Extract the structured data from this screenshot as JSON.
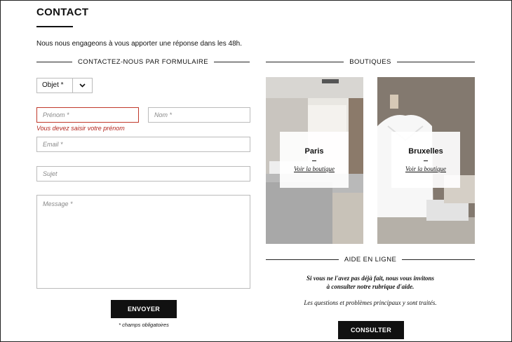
{
  "page": {
    "title": "CONTACT",
    "intro": "Nous nous engageons à vous apporter une réponse dans les 48h."
  },
  "form": {
    "section_title": "CONTACTEZ-NOUS PAR FORMULAIRE",
    "object_select": {
      "value": "Objet *"
    },
    "first_name": {
      "placeholder": "Prénom *",
      "error": "Vous devez saisir votre prénom"
    },
    "last_name": {
      "placeholder": "Nom *"
    },
    "email": {
      "placeholder": "Email *"
    },
    "subject": {
      "placeholder": "Sujet"
    },
    "message": {
      "placeholder": "Message *"
    },
    "submit_label": "ENVOYER",
    "required_note": "* champs obligatoires"
  },
  "shops": {
    "section_title": "BOUTIQUES",
    "items": [
      {
        "name": "Paris",
        "link": "Voir la boutique"
      },
      {
        "name": "Bruxelles",
        "link": "Voir la boutique"
      }
    ]
  },
  "help": {
    "section_title": "AIDE EN LIGNE",
    "line1": "Si vous ne l'avez pas déjà fait, nous vous invitons",
    "line2": "à consulter notre rubrique d'aide.",
    "line3": "Les questions et problèmes principaux y sont traités.",
    "button_label": "CONSULTER"
  },
  "colors": {
    "error": "#b3261e",
    "button": "#111111"
  }
}
